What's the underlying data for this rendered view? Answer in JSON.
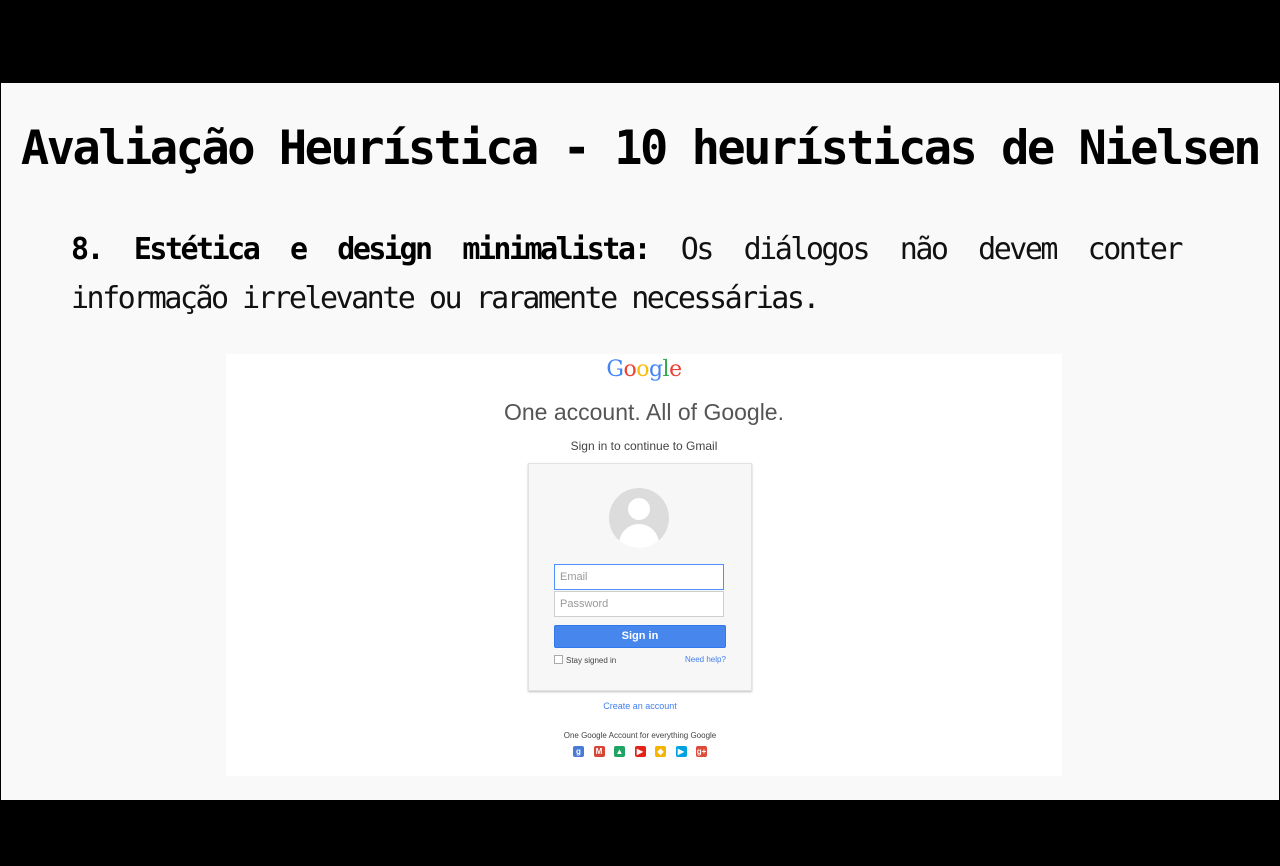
{
  "slide": {
    "title": "Avaliação Heurística - 10 heurísticas de Nielsen",
    "lead": "8. Estética e design minimalista:",
    "body": " Os diálogos não devem conter informação irrelevante ou raramente necessárias."
  },
  "screenshot": {
    "logo_letters": [
      {
        "char": "G",
        "color": "#4285f4"
      },
      {
        "char": "o",
        "color": "#ea4335"
      },
      {
        "char": "o",
        "color": "#fbbc05"
      },
      {
        "char": "g",
        "color": "#4285f4"
      },
      {
        "char": "l",
        "color": "#34a853"
      },
      {
        "char": "e",
        "color": "#ea4335"
      }
    ],
    "headline": "One account. All of Google.",
    "subheadline": "Sign in to continue to Gmail",
    "email_placeholder": "Email",
    "password_placeholder": "Password",
    "signin_label": "Sign in",
    "stay_signed_in": "Stay signed in",
    "need_help": "Need help?",
    "create_account": "Create an account",
    "footer": "One Google Account for everything Google",
    "app_icons": [
      {
        "name": "google-plus-icon",
        "glyph": "g",
        "color": "#4a7bd4"
      },
      {
        "name": "gmail-icon",
        "glyph": "M",
        "color": "#d44638"
      },
      {
        "name": "drive-icon",
        "glyph": "▲",
        "color": "#1fa463"
      },
      {
        "name": "youtube-icon",
        "glyph": "▶",
        "color": "#e62117"
      },
      {
        "name": "maps-icon",
        "glyph": "◆",
        "color": "#f4b400"
      },
      {
        "name": "play-icon",
        "glyph": "▶",
        "color": "#00a3e0"
      },
      {
        "name": "google-plus-red-icon",
        "glyph": "g+",
        "color": "#dd4b39"
      }
    ]
  }
}
